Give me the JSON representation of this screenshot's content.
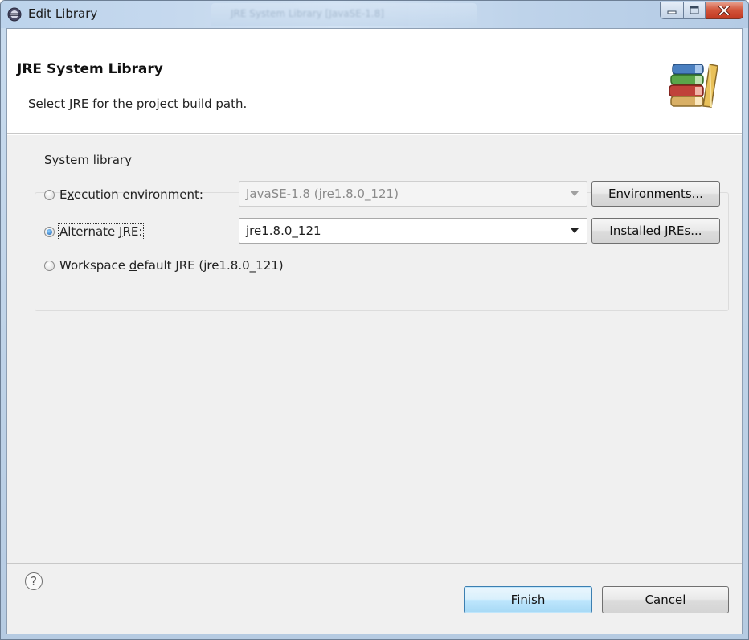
{
  "window": {
    "title": "Edit Library",
    "background_tab_text": "JRE System Library [JavaSE-1.8]"
  },
  "header": {
    "title": "JRE System Library",
    "description": "Select JRE for the project build path.",
    "icon": "library-books-icon"
  },
  "system_library": {
    "group_label": "System library",
    "options": [
      {
        "label_pre": "E",
        "label_mnemonic": "x",
        "label_post": "ecution environment:",
        "selected": false,
        "combo_value": "JavaSE-1.8 (jre1.8.0_121)",
        "combo_enabled": false,
        "button_pre": "Envir",
        "button_mnemonic": "o",
        "button_post": "nments..."
      },
      {
        "label_pre": "Alternate ",
        "label_mnemonic": "J",
        "label_post": "RE:",
        "selected": true,
        "combo_value": "jre1.8.0_121",
        "combo_enabled": true,
        "button_pre": "",
        "button_mnemonic": "I",
        "button_post": "nstalled JREs..."
      },
      {
        "label_pre": "Workspace ",
        "label_mnemonic": "d",
        "label_post": "efault JRE (jre1.8.0_121)",
        "selected": false
      }
    ]
  },
  "footer": {
    "help_symbol": "?",
    "finish_pre": "",
    "finish_mnemonic": "F",
    "finish_post": "inish",
    "cancel_label": "Cancel"
  },
  "colors": {
    "accent": "#3c7fb1",
    "close_button": "#c23a22"
  }
}
